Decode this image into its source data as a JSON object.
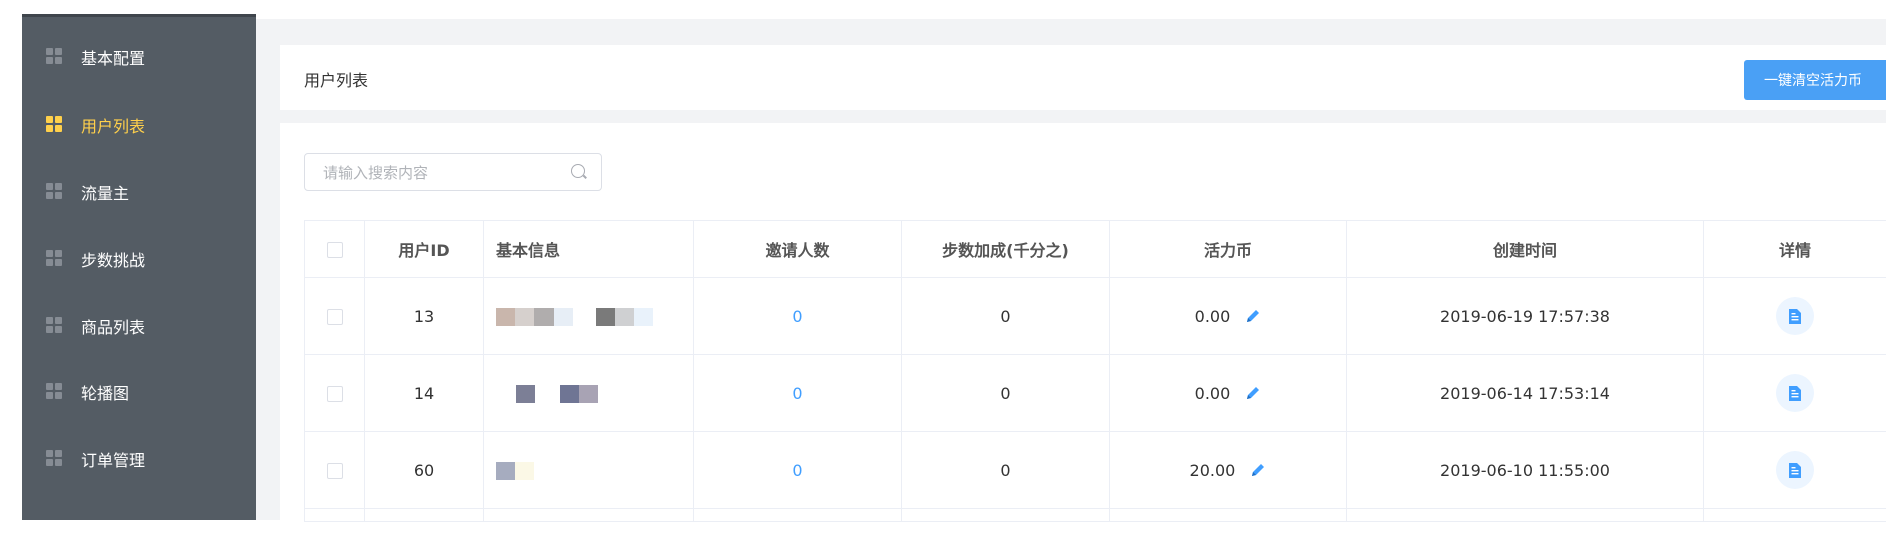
{
  "sidebar": {
    "items": [
      {
        "label": "基本配置",
        "active": false
      },
      {
        "label": "用户列表",
        "active": true
      },
      {
        "label": "流量主",
        "active": false
      },
      {
        "label": "步数挑战",
        "active": false
      },
      {
        "label": "商品列表",
        "active": false
      },
      {
        "label": "轮播图",
        "active": false
      },
      {
        "label": "订单管理",
        "active": false
      }
    ]
  },
  "header": {
    "title": "用户列表",
    "clear_button": "一键清空活力币"
  },
  "search": {
    "placeholder": "请输入搜索内容",
    "value": ""
  },
  "table": {
    "columns": [
      "用户ID",
      "基本信息",
      "邀请人数",
      "步数加成(千分之)",
      "活力币",
      "创建时间",
      "详情"
    ],
    "rows": [
      {
        "user_id": "13",
        "invites": "0",
        "step_bonus": "0",
        "coins": "0.00",
        "created": "2019-06-19 17:57:38"
      },
      {
        "user_id": "14",
        "invites": "0",
        "step_bonus": "0",
        "coins": "0.00",
        "created": "2019-06-14 17:53:14"
      },
      {
        "user_id": "60",
        "invites": "0",
        "step_bonus": "0",
        "coins": "20.00",
        "created": "2019-06-10 11:55:00"
      }
    ]
  },
  "colors": {
    "sidebar_bg": "#545c64",
    "active_accent": "#ffd04b",
    "primary": "#409eff",
    "button_bg": "#4aa0f5",
    "page_bg": "#f2f3f5"
  },
  "icons": {
    "menu": "grid-icon",
    "search": "search-icon",
    "edit": "pencil-icon",
    "detail": "document-icon"
  }
}
